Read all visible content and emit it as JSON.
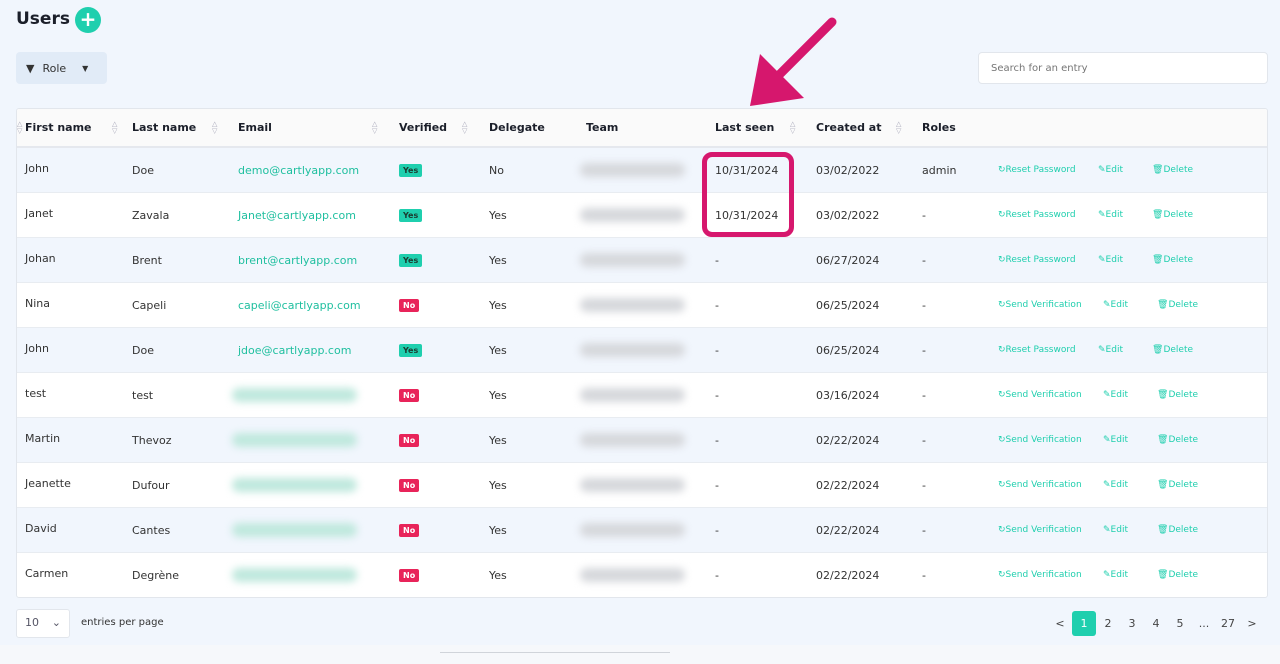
{
  "title": "Users",
  "add_label": "+",
  "filter": {
    "label": "Role"
  },
  "search": {
    "placeholder": "Search for an entry"
  },
  "columns": [
    "First name",
    "Last name",
    "Email",
    "Verified",
    "Delegate",
    "Team",
    "Last seen",
    "Created at",
    "Roles"
  ],
  "rows": [
    {
      "first": "John",
      "last": "Doe",
      "email": "demo@cartlyapp.com",
      "verified": "Yes",
      "delegate": "No",
      "last_seen": "10/31/2024",
      "created": "03/02/2022",
      "roles": "admin",
      "action": "Reset Password"
    },
    {
      "first": "Janet",
      "last": "Zavala",
      "email": "Janet@cartlyapp.com",
      "verified": "Yes",
      "delegate": "Yes",
      "last_seen": "10/31/2024",
      "created": "03/02/2022",
      "roles": "-",
      "action": "Reset Password"
    },
    {
      "first": "Johan",
      "last": "Brent",
      "email": "brent@cartlyapp.com",
      "verified": "Yes",
      "delegate": "Yes",
      "last_seen": "-",
      "created": "06/27/2024",
      "roles": "-",
      "action": "Reset Password"
    },
    {
      "first": "Nina",
      "last": "Capeli",
      "email": "capeli@cartlyapp.com",
      "verified": "No",
      "delegate": "Yes",
      "last_seen": "-",
      "created": "06/25/2024",
      "roles": "-",
      "action": "Send Verification"
    },
    {
      "first": "John",
      "last": "Doe",
      "email": "jdoe@cartlyapp.com",
      "verified": "Yes",
      "delegate": "Yes",
      "last_seen": "-",
      "created": "06/25/2024",
      "roles": "-",
      "action": "Reset Password"
    },
    {
      "first": "test",
      "last": "test",
      "email": "",
      "verified": "No",
      "delegate": "Yes",
      "last_seen": "-",
      "created": "03/16/2024",
      "roles": "-",
      "action": "Send Verification"
    },
    {
      "first": "Martin",
      "last": "Thevoz",
      "email": "",
      "verified": "No",
      "delegate": "Yes",
      "last_seen": "-",
      "created": "02/22/2024",
      "roles": "-",
      "action": "Send Verification"
    },
    {
      "first": "Jeanette",
      "last": "Dufour",
      "email": "",
      "verified": "No",
      "delegate": "Yes",
      "last_seen": "-",
      "created": "02/22/2024",
      "roles": "-",
      "action": "Send Verification"
    },
    {
      "first": "David",
      "last": "Cantes",
      "email": "",
      "verified": "No",
      "delegate": "Yes",
      "last_seen": "-",
      "created": "02/22/2024",
      "roles": "-",
      "action": "Send Verification"
    },
    {
      "first": "Carmen",
      "last": "Degrène",
      "email": "",
      "verified": "No",
      "delegate": "Yes",
      "last_seen": "-",
      "created": "02/22/2024",
      "roles": "-",
      "action": "Send Verification"
    }
  ],
  "actions": {
    "edit": "Edit",
    "delete": "Delete"
  },
  "footer": {
    "per_page": "10",
    "per_page_label": "entries per page",
    "pages": [
      "<",
      "1",
      "2",
      "3",
      "4",
      "5",
      "...",
      "27",
      ">"
    ],
    "current": "1"
  }
}
